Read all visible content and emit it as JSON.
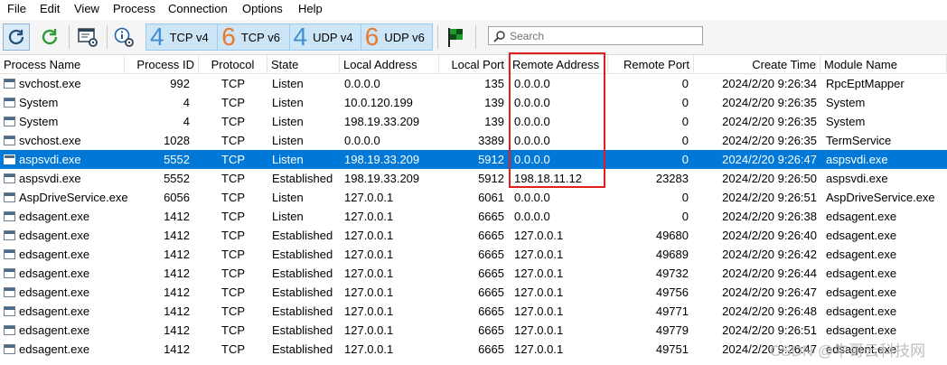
{
  "menu": [
    "File",
    "Edit",
    "View",
    "Process",
    "Connection",
    "Options",
    "Help"
  ],
  "toolbar": {
    "protocols": [
      {
        "num": "4",
        "label": "TCP v4",
        "color": "#3f8fd2"
      },
      {
        "num": "6",
        "label": "TCP v6",
        "color": "#e67a2e"
      },
      {
        "num": "4",
        "label": "UDP v4",
        "color": "#3f8fd2"
      },
      {
        "num": "6",
        "label": "UDP v6",
        "color": "#e67a2e"
      }
    ],
    "search_placeholder": "Search"
  },
  "columns": [
    "Process Name",
    "Process ID",
    "Protocol",
    "State",
    "Local Address",
    "Local Port",
    "Remote Address",
    "Remote Port",
    "Create Time",
    "Module Name"
  ],
  "rows": [
    {
      "name": "svchost.exe",
      "pid": "992",
      "proto": "TCP",
      "state": "Listen",
      "laddr": "0.0.0.0",
      "lport": "135",
      "raddr": "0.0.0.0",
      "rport": "0",
      "time": "2024/2/20 9:26:34",
      "module": "RpcEptMapper",
      "selected": false
    },
    {
      "name": "System",
      "pid": "4",
      "proto": "TCP",
      "state": "Listen",
      "laddr": "10.0.120.199",
      "lport": "139",
      "raddr": "0.0.0.0",
      "rport": "0",
      "time": "2024/2/20 9:26:35",
      "module": "System",
      "selected": false
    },
    {
      "name": "System",
      "pid": "4",
      "proto": "TCP",
      "state": "Listen",
      "laddr": "198.19.33.209",
      "lport": "139",
      "raddr": "0.0.0.0",
      "rport": "0",
      "time": "2024/2/20 9:26:35",
      "module": "System",
      "selected": false
    },
    {
      "name": "svchost.exe",
      "pid": "1028",
      "proto": "TCP",
      "state": "Listen",
      "laddr": "0.0.0.0",
      "lport": "3389",
      "raddr": "0.0.0.0",
      "rport": "0",
      "time": "2024/2/20 9:26:35",
      "module": "TermService",
      "selected": false
    },
    {
      "name": "aspsvdi.exe",
      "pid": "5552",
      "proto": "TCP",
      "state": "Listen",
      "laddr": "198.19.33.209",
      "lport": "5912",
      "raddr": "0.0.0.0",
      "rport": "0",
      "time": "2024/2/20 9:26:47",
      "module": "aspsvdi.exe",
      "selected": true
    },
    {
      "name": "aspsvdi.exe",
      "pid": "5552",
      "proto": "TCP",
      "state": "Established",
      "laddr": "198.19.33.209",
      "lport": "5912",
      "raddr": "198.18.11.12",
      "rport": "23283",
      "time": "2024/2/20 9:26:50",
      "module": "aspsvdi.exe",
      "selected": false
    },
    {
      "name": "AspDriveService.exe",
      "pid": "6056",
      "proto": "TCP",
      "state": "Listen",
      "laddr": "127.0.0.1",
      "lport": "6061",
      "raddr": "0.0.0.0",
      "rport": "0",
      "time": "2024/2/20 9:26:51",
      "module": "AspDriveService.exe",
      "selected": false
    },
    {
      "name": "edsagent.exe",
      "pid": "1412",
      "proto": "TCP",
      "state": "Listen",
      "laddr": "127.0.0.1",
      "lport": "6665",
      "raddr": "0.0.0.0",
      "rport": "0",
      "time": "2024/2/20 9:26:38",
      "module": "edsagent.exe",
      "selected": false
    },
    {
      "name": "edsagent.exe",
      "pid": "1412",
      "proto": "TCP",
      "state": "Established",
      "laddr": "127.0.0.1",
      "lport": "6665",
      "raddr": "127.0.0.1",
      "rport": "49680",
      "time": "2024/2/20 9:26:40",
      "module": "edsagent.exe",
      "selected": false
    },
    {
      "name": "edsagent.exe",
      "pid": "1412",
      "proto": "TCP",
      "state": "Established",
      "laddr": "127.0.0.1",
      "lport": "6665",
      "raddr": "127.0.0.1",
      "rport": "49689",
      "time": "2024/2/20 9:26:42",
      "module": "edsagent.exe",
      "selected": false
    },
    {
      "name": "edsagent.exe",
      "pid": "1412",
      "proto": "TCP",
      "state": "Established",
      "laddr": "127.0.0.1",
      "lport": "6665",
      "raddr": "127.0.0.1",
      "rport": "49732",
      "time": "2024/2/20 9:26:44",
      "module": "edsagent.exe",
      "selected": false
    },
    {
      "name": "edsagent.exe",
      "pid": "1412",
      "proto": "TCP",
      "state": "Established",
      "laddr": "127.0.0.1",
      "lport": "6665",
      "raddr": "127.0.0.1",
      "rport": "49756",
      "time": "2024/2/20 9:26:47",
      "module": "edsagent.exe",
      "selected": false
    },
    {
      "name": "edsagent.exe",
      "pid": "1412",
      "proto": "TCP",
      "state": "Established",
      "laddr": "127.0.0.1",
      "lport": "6665",
      "raddr": "127.0.0.1",
      "rport": "49771",
      "time": "2024/2/20 9:26:48",
      "module": "edsagent.exe",
      "selected": false
    },
    {
      "name": "edsagent.exe",
      "pid": "1412",
      "proto": "TCP",
      "state": "Established",
      "laddr": "127.0.0.1",
      "lport": "6665",
      "raddr": "127.0.0.1",
      "rport": "49779",
      "time": "2024/2/20 9:26:51",
      "module": "edsagent.exe",
      "selected": false
    },
    {
      "name": "edsagent.exe",
      "pid": "1412",
      "proto": "TCP",
      "state": "Established",
      "laddr": "127.0.0.1",
      "lport": "6665",
      "raddr": "127.0.0.1",
      "rport": "49751",
      "time": "2024/2/20 9:26:47",
      "module": "edsagent.exe",
      "selected": false
    }
  ],
  "watermark": "CSDN @牛哥云科技网",
  "colors": {
    "selection": "#0078d7",
    "highlight": "#e0201c"
  }
}
